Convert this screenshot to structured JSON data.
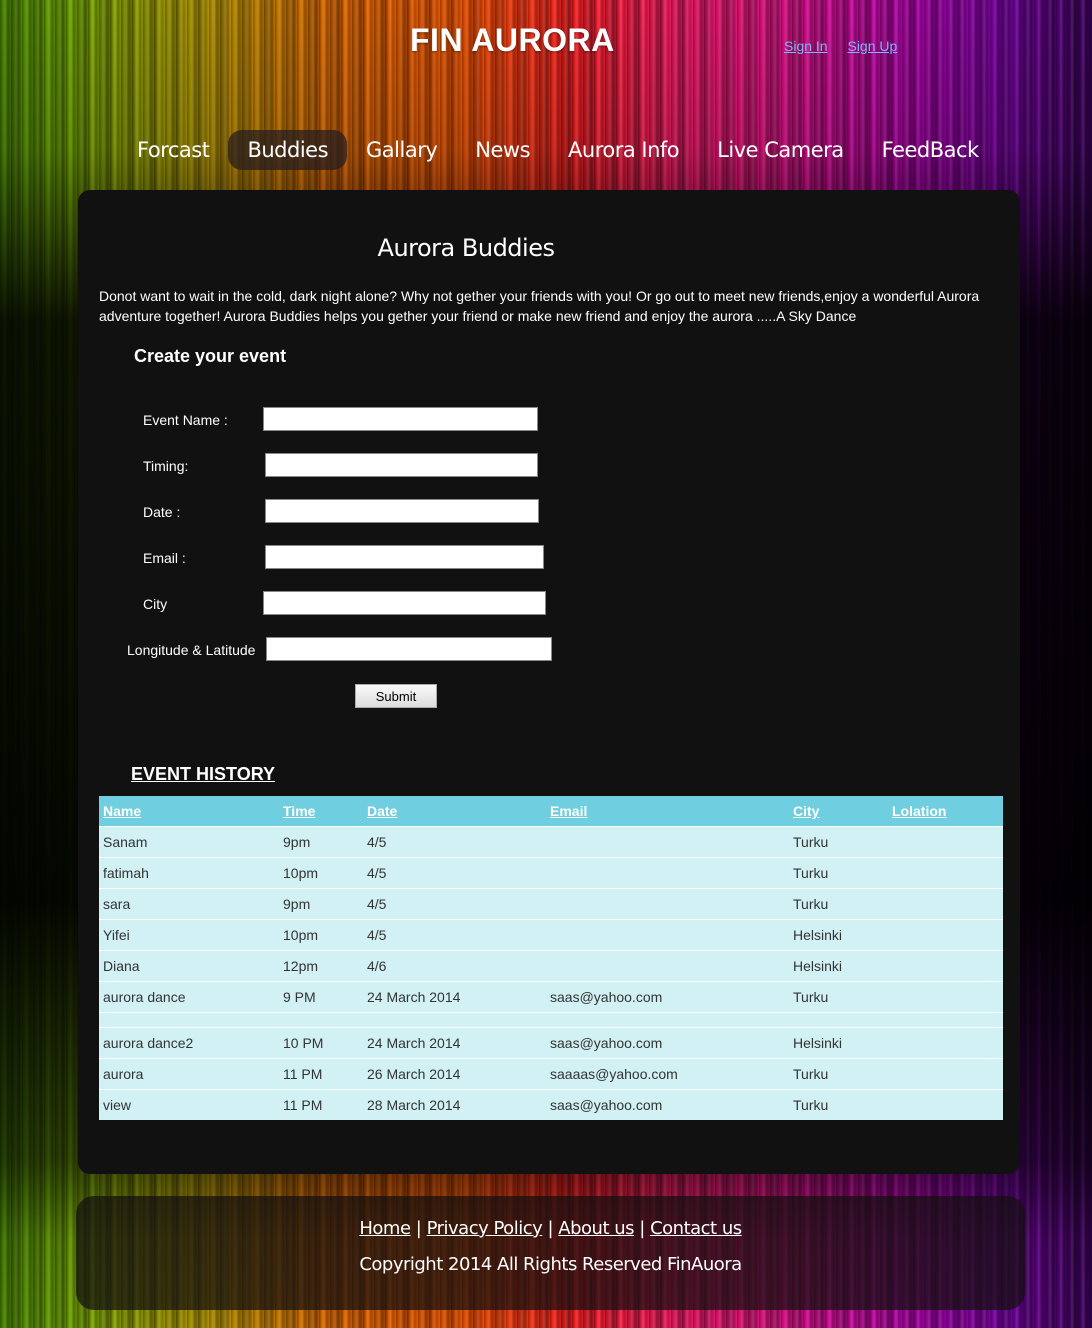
{
  "header": {
    "logo": "FIN AURORA",
    "sign_in": "Sign In",
    "sign_up": "Sign Up"
  },
  "nav": [
    {
      "label": "Forcast"
    },
    {
      "label": "Buddies",
      "active": true
    },
    {
      "label": "Gallary"
    },
    {
      "label": "News"
    },
    {
      "label": "Aurora Info"
    },
    {
      "label": "Live Camera"
    },
    {
      "label": "FeedBack"
    }
  ],
  "main": {
    "title": "Aurora Buddies",
    "intro": "Donot want to wait in the cold, dark night alone?  Why not gether your friends with you! Or go out to meet new friends,enjoy a wonderful Aurora adventure together! Aurora Buddies helps you gether your friend or make new friend and enjoy the aurora .....A Sky Dance",
    "create_heading": "Create your event",
    "form": {
      "event_name_label": "Event Name :",
      "event_name_value": "",
      "timing_label": "Timing:",
      "timing_value": "",
      "date_label": "Date  :",
      "date_value": "",
      "email_label": "Email :",
      "email_value": "",
      "city_label": "City",
      "city_value": "",
      "lonlat_label": "Longitude & Latitude",
      "lonlat_value": "",
      "submit_label": "Submit"
    },
    "history_heading": "EVENT HISTORY",
    "table": {
      "headers": [
        "Name",
        "Time",
        "Date",
        "Email",
        "City",
        "Lolation"
      ],
      "rows": [
        [
          "Sanam",
          "9pm",
          "4/5",
          "",
          "Turku",
          ""
        ],
        [
          "fatimah",
          "10pm",
          "4/5",
          "",
          "Turku",
          ""
        ],
        [
          "sara",
          "9pm",
          "4/5",
          "",
          "Turku",
          ""
        ],
        [
          "Yifei",
          "10pm",
          "4/5",
          "",
          "Helsinki",
          ""
        ],
        [
          "Diana",
          "12pm",
          "4/6",
          "",
          "Helsinki",
          ""
        ],
        [
          "aurora dance",
          "9 PM",
          "24 March 2014",
          "saas@yahoo.com",
          "Turku",
          ""
        ],
        [
          "",
          "",
          "",
          "",
          "",
          ""
        ],
        [
          "aurora dance2",
          "10 PM",
          "24 March 2014",
          "saas@yahoo.com",
          "Helsinki",
          ""
        ],
        [
          "aurora",
          "11 PM",
          "26 March 2014",
          "saaaas@yahoo.com",
          "Turku",
          ""
        ],
        [
          "view",
          "11 PM",
          "28 March 2014",
          "saas@yahoo.com",
          "Turku",
          ""
        ]
      ]
    }
  },
  "footer": {
    "links": [
      "Home",
      "Privacy Policy",
      "About us",
      "Contact us"
    ],
    "separator": "|",
    "copyright": "Copyright 2014 All Rights Reserved FinAuora"
  }
}
